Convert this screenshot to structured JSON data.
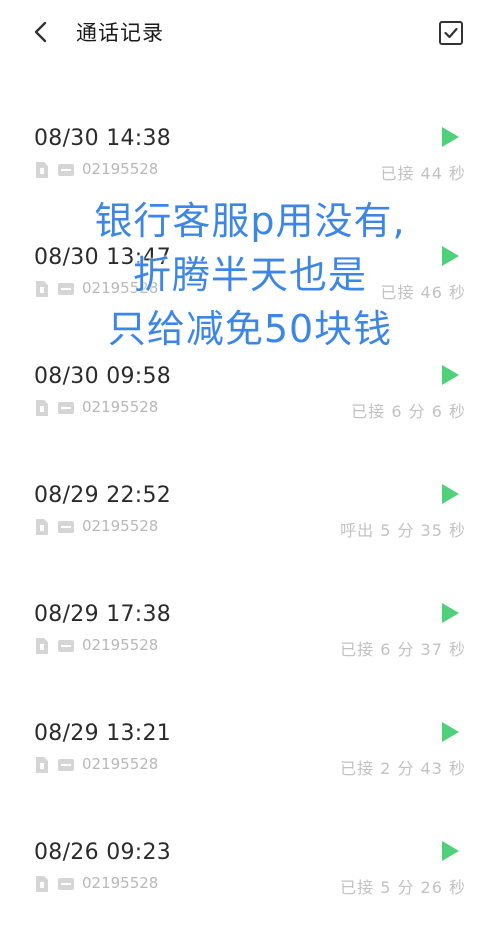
{
  "header": {
    "title": "通话记录",
    "back_icon": "chevron-left-icon",
    "select_icon": "checkbox-icon"
  },
  "calls": [
    {
      "time": "08/30 14:38",
      "number": "02195528",
      "status": "已接 44 秒"
    },
    {
      "time": "08/30 13:47",
      "number": "02195528",
      "status": "已接 46 秒"
    },
    {
      "time": "08/30 09:58",
      "number": "02195528",
      "status": "已接 6 分 6 秒"
    },
    {
      "time": "08/29 22:52",
      "number": "02195528",
      "status": "呼出 5 分 35 秒"
    },
    {
      "time": "08/29 17:38",
      "number": "02195528",
      "status": "已接 6 分 37 秒"
    },
    {
      "time": "08/29 13:21",
      "number": "02195528",
      "status": "已接 2 分 43 秒"
    },
    {
      "time": "08/26 09:23",
      "number": "02195528",
      "status": "已接 5 分 26 秒"
    }
  ],
  "overlay_text": {
    "line1": "银行客服p用没有,",
    "line2": "折腾半天也是",
    "line3": "只给减免50块钱"
  },
  "colors": {
    "play": "#4fd07b",
    "overlay": "#3d86e6",
    "muted": "#c2c2c2"
  }
}
